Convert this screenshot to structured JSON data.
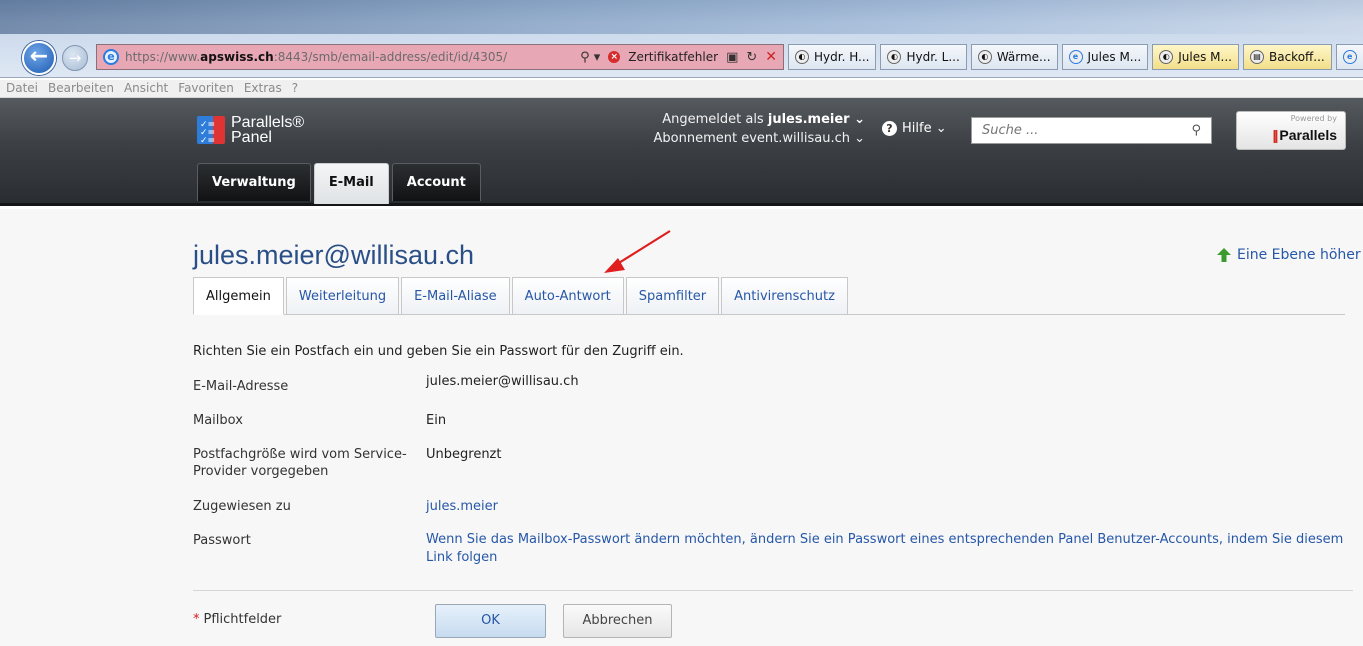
{
  "browser": {
    "url_prefix": "https://www.",
    "url_domain": "apswiss.ch",
    "url_suffix": ":8443/smb/email-address/edit/id/4305/",
    "search_glyph": "⚲ ▾",
    "cert_error": "Zertifikatfehler",
    "tabs": [
      {
        "label": "Hydr. H...",
        "icon": "ie-page-icon"
      },
      {
        "label": "Hydr. L...",
        "icon": "ie-page-icon"
      },
      {
        "label": "Wärme...",
        "icon": "ie-page-icon"
      },
      {
        "label": "Jules M...",
        "icon": "ie-icon"
      },
      {
        "label": "Jules M...",
        "icon": "ie-page-icon"
      },
      {
        "label": "Backoff...",
        "icon": "doc-icon"
      }
    ],
    "menu": [
      "Datei",
      "Bearbeiten",
      "Ansicht",
      "Favoriten",
      "Extras",
      "?"
    ]
  },
  "header": {
    "logo_line1": "Parallels®",
    "logo_line2": "Panel",
    "logged_in_prefix": "Angemeldet als",
    "user": "jules.meier ⌄",
    "subscription_prefix": "Abonnement",
    "subscription": "event.willisau.ch ⌄",
    "help": "Hilfe ⌄",
    "search_placeholder": "Suche ...",
    "powered_by": "Powered by",
    "powered_brand": "Parallels",
    "tabs": [
      "Verwaltung",
      "E-Mail",
      "Account"
    ],
    "active_tab": "E-Mail"
  },
  "page": {
    "title": "jules.meier@willisau.ch",
    "up_level": "Eine Ebene höher",
    "tabs": [
      "Allgemein",
      "Weiterleitung",
      "E-Mail-Aliase",
      "Auto-Antwort",
      "Spamfilter",
      "Antivirenschutz"
    ],
    "active_tab": "Allgemein",
    "intro": "Richten Sie ein Postfach ein und geben Sie ein Passwort für den Zugriff ein.",
    "fields": [
      {
        "label": "E-Mail-Adresse",
        "value": "jules.meier@willisau.ch"
      },
      {
        "label": "Mailbox",
        "value": "Ein"
      },
      {
        "label": "Postfachgröße wird vom Service-Provider vorgegeben",
        "value": "Unbegrenzt"
      },
      {
        "label": "Zugewiesen zu",
        "value": "jules.meier"
      },
      {
        "label": "Passwort",
        "value": "Wenn Sie das Mailbox-Passwort ändern möchten, ändern Sie ein Passwort eines entsprechenden Panel Benutzer-Accounts, indem Sie diesem Link folgen"
      }
    ],
    "required_label": "Pflichtfelder",
    "required_marker": "*",
    "ok_label": "OK",
    "cancel_label": "Abbrechen"
  },
  "colors": {
    "link": "#2657a7",
    "title": "#2a4f86",
    "annotation_arrow": "#e01e1e",
    "address_bar_error": "#e8a7b5"
  }
}
